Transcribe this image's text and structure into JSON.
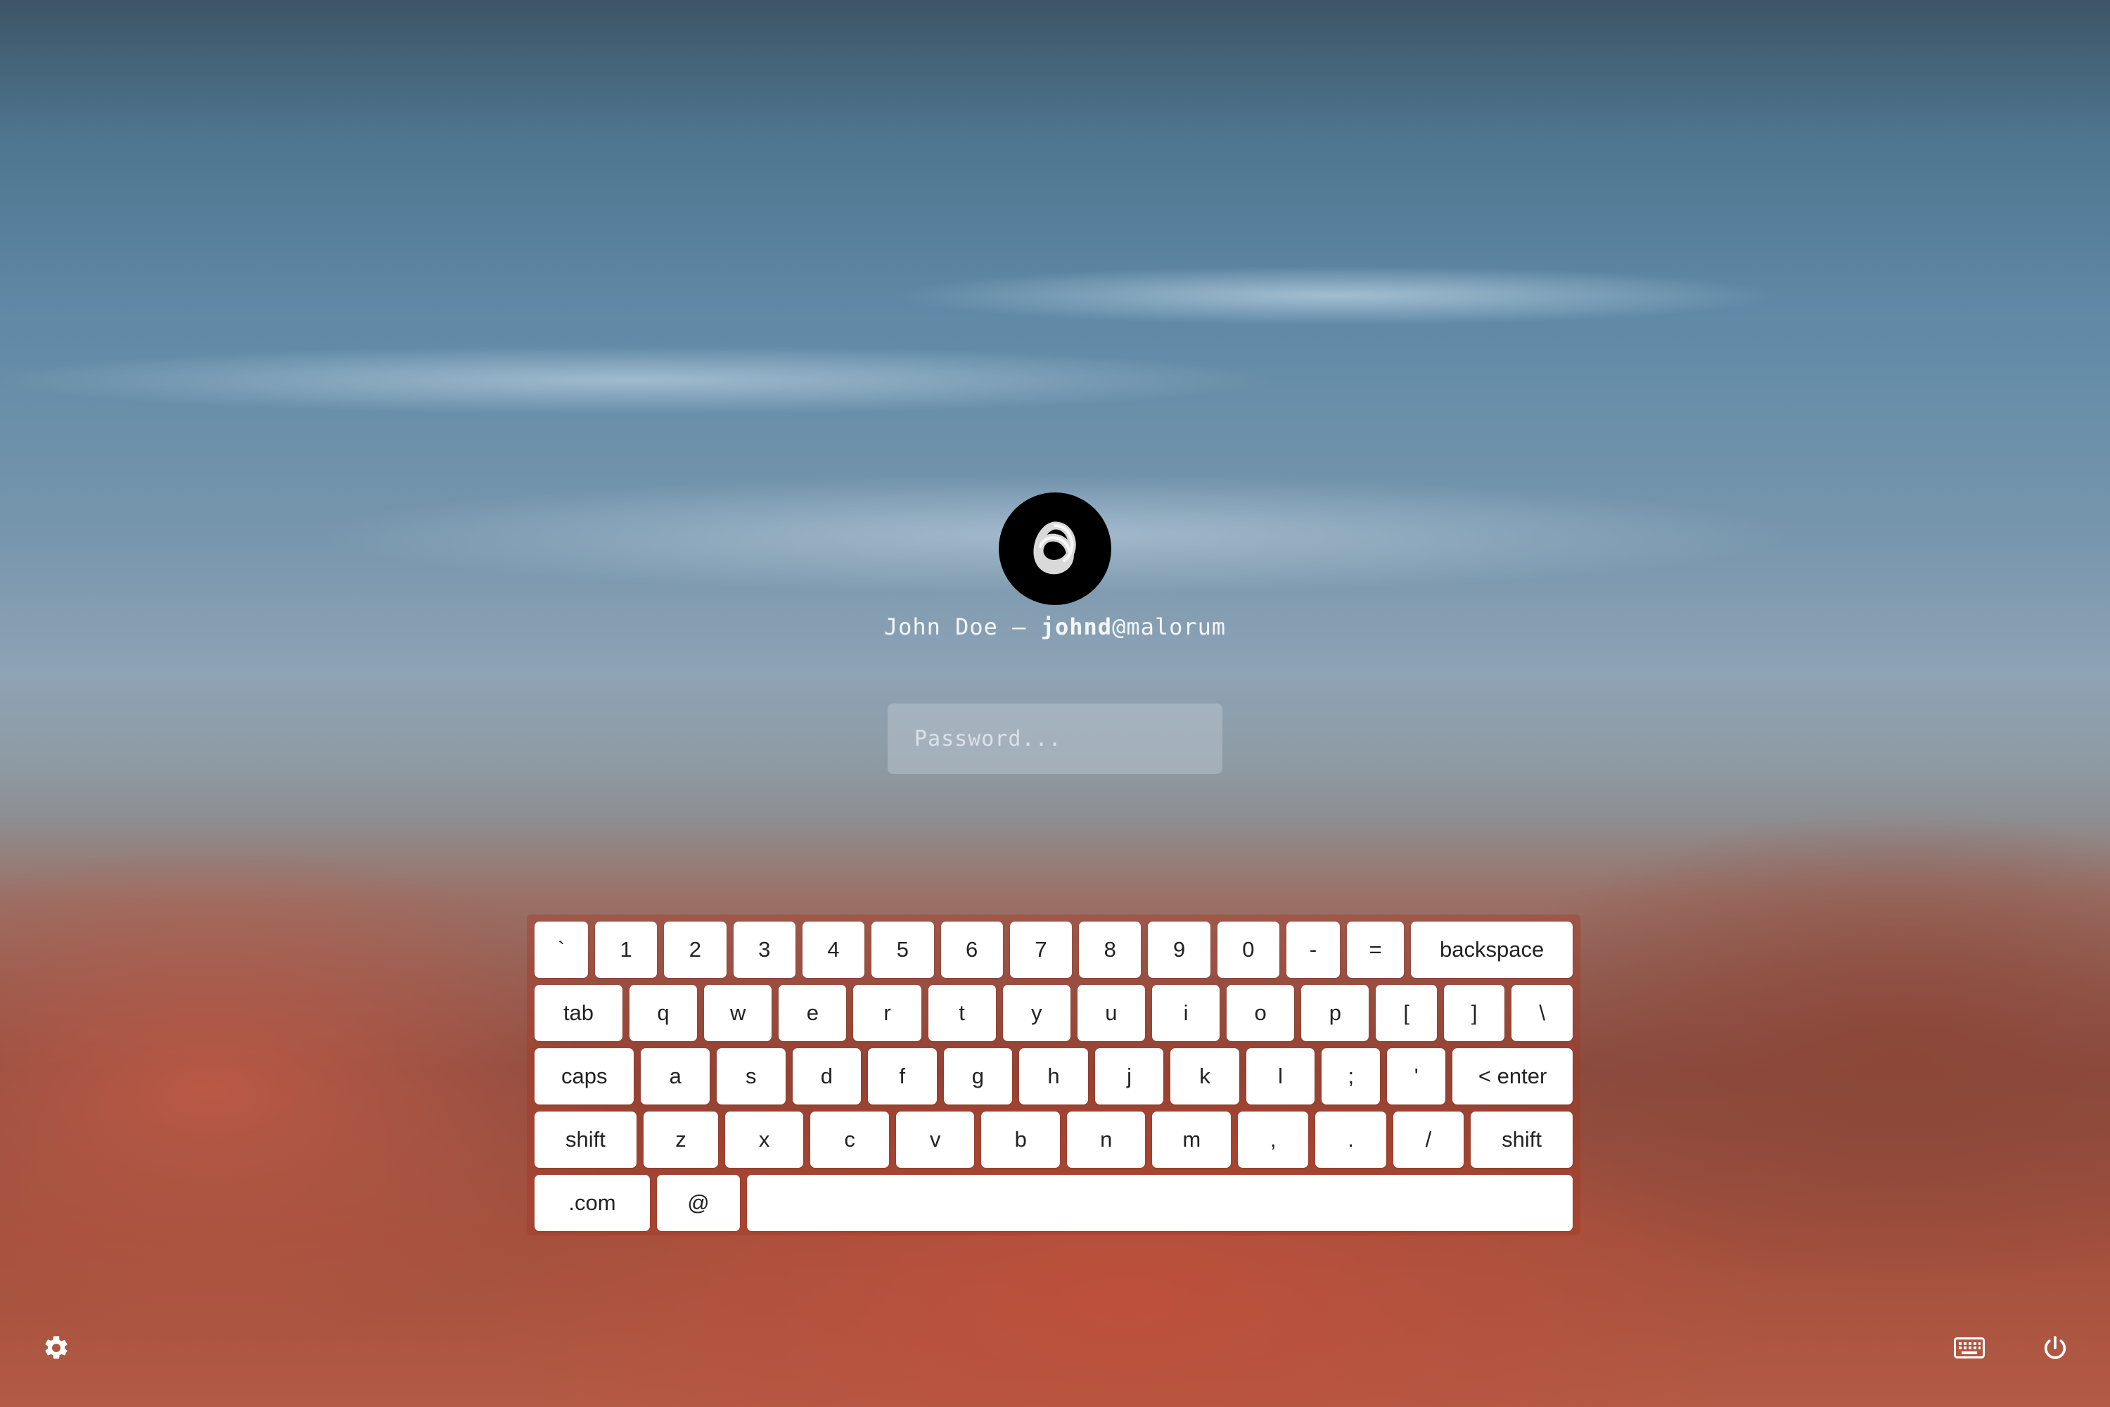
{
  "user": {
    "display_name": "John Doe",
    "separator": "—",
    "username": "johnd",
    "host": "@malorum",
    "avatar_icon": "knot-logo-icon"
  },
  "password": {
    "placeholder": "Password...",
    "value": ""
  },
  "keyboard": {
    "rows": [
      [
        "`",
        "1",
        "2",
        "3",
        "4",
        "5",
        "6",
        "7",
        "8",
        "9",
        "0",
        "-",
        "=",
        "backspace"
      ],
      [
        "tab",
        "q",
        "w",
        "e",
        "r",
        "t",
        "y",
        "u",
        "i",
        "o",
        "p",
        "[",
        "]",
        "\\"
      ],
      [
        "caps",
        "a",
        "s",
        "d",
        "f",
        "g",
        "h",
        "j",
        "k",
        "l",
        ";",
        "'",
        "< enter"
      ],
      [
        "shift",
        "z",
        "x",
        "c",
        "v",
        "b",
        "n",
        "m",
        ",",
        ".",
        "/",
        "shift"
      ],
      [
        ".com",
        "@",
        ""
      ]
    ]
  },
  "bottom_bar": {
    "left_icon": "gear-icon",
    "right_icons": [
      "keyboard-icon",
      "power-icon"
    ]
  }
}
